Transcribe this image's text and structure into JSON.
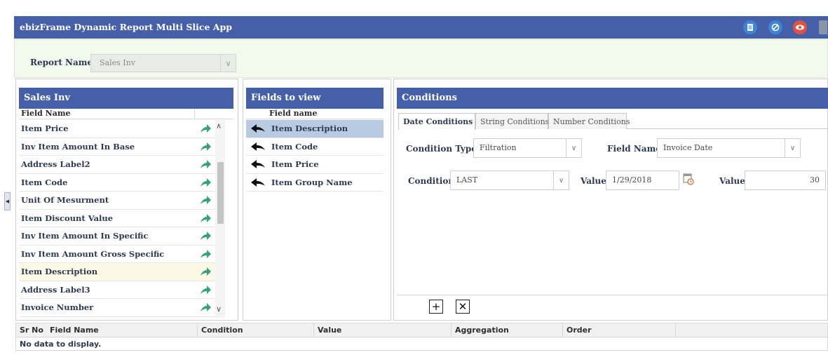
{
  "app": {
    "title": "ebizFrame Dynamic Report Multi Slice App",
    "header_icons": [
      "document-icon",
      "no-entry-icon",
      "eye-icon",
      "clipboard-icon"
    ]
  },
  "report": {
    "label": "Report Name",
    "value": "Sales Inv"
  },
  "sales_panel": {
    "title": "Sales Inv",
    "column": "Field Name",
    "items": [
      {
        "label": "Item Price"
      },
      {
        "label": "Inv Item Amount In Base"
      },
      {
        "label": "Address Label2"
      },
      {
        "label": "Item Code"
      },
      {
        "label": "Unit Of Mesurment"
      },
      {
        "label": "Item Discount Value"
      },
      {
        "label": "Inv Item Amount In Specific"
      },
      {
        "label": "Inv Item Amount Gross Specific"
      },
      {
        "label": "Item Description",
        "highlighted": true
      },
      {
        "label": "Address Label3"
      },
      {
        "label": "Invoice Number"
      }
    ]
  },
  "fields_panel": {
    "title": "Fields to view",
    "column": "Field name",
    "items": [
      {
        "label": "Item Description",
        "selected": true
      },
      {
        "label": "Item Code"
      },
      {
        "label": "Item Price"
      },
      {
        "label": "Item Group Name"
      }
    ]
  },
  "conditions": {
    "title": "Conditions",
    "tabs": [
      "Date Conditions",
      "String Conditions",
      "Number Conditions"
    ],
    "active_tab": "Date Conditions",
    "condition_type_label": "Condition Type",
    "condition_type_value": "Filtration",
    "field_name_label": "Field Name",
    "field_name_value": "Invoice Date",
    "condition_label": "Condition",
    "condition_value": "LAST",
    "value_label": "Value",
    "date_value": "1/29/2018",
    "value2_label": "Value",
    "number_value": "30"
  },
  "grid": {
    "columns": [
      "Sr No",
      "Field Name",
      "Condition",
      "Value",
      "Aggregation",
      "Order"
    ],
    "empty_text": "No data to display."
  },
  "colors": {
    "header_blue": "#4560a8",
    "report_band": "#f2f9ed",
    "arrow_green": "#37a27a",
    "selected_row": "#b9cbe2",
    "highlighted_row": "#fbf9e6"
  }
}
